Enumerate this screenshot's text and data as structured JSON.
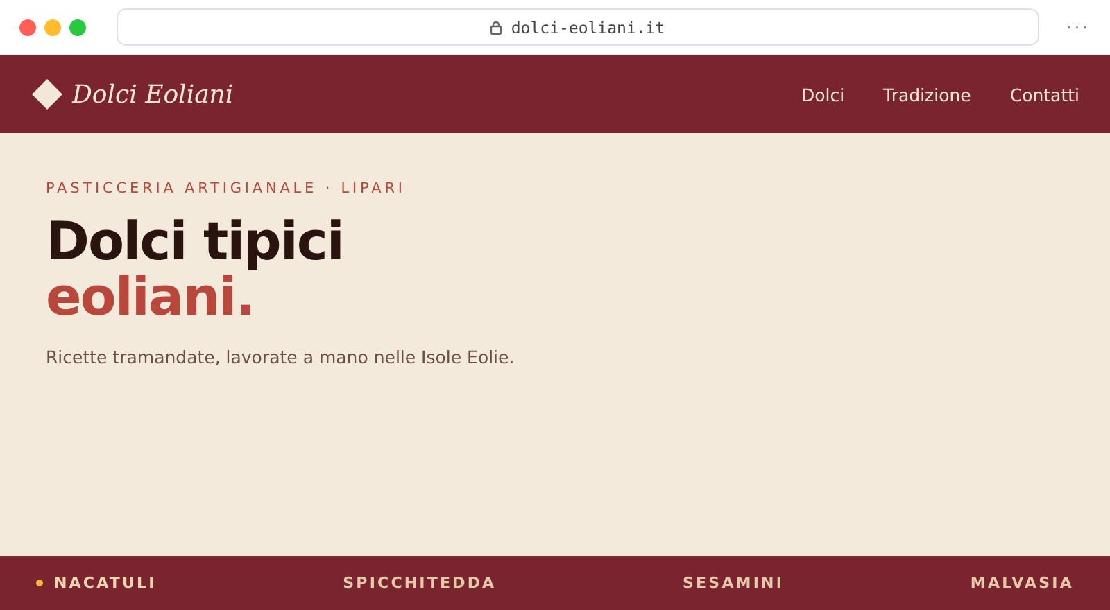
{
  "browser": {
    "url": "dolci-eoliani.it",
    "menu": "···"
  },
  "nav": {
    "brand": "Dolci Eoliani",
    "links": [
      "Dolci",
      "Tradizione",
      "Contatti"
    ]
  },
  "hero": {
    "eyebrow": "PASTICCERIA ARTIGIANALE · LIPARI",
    "title_line1": "Dolci tipici",
    "title_line2": "eoliani.",
    "subtitle": "Ricette tramandate, lavorate a mano nelle Isole Eolie."
  },
  "strip": [
    {
      "label": "NACATULI",
      "selected": true
    },
    {
      "label": "SPICCHITEDDA",
      "selected": false
    },
    {
      "label": "SESAMINI",
      "selected": false
    },
    {
      "label": "MALVASIA",
      "selected": false
    }
  ]
}
